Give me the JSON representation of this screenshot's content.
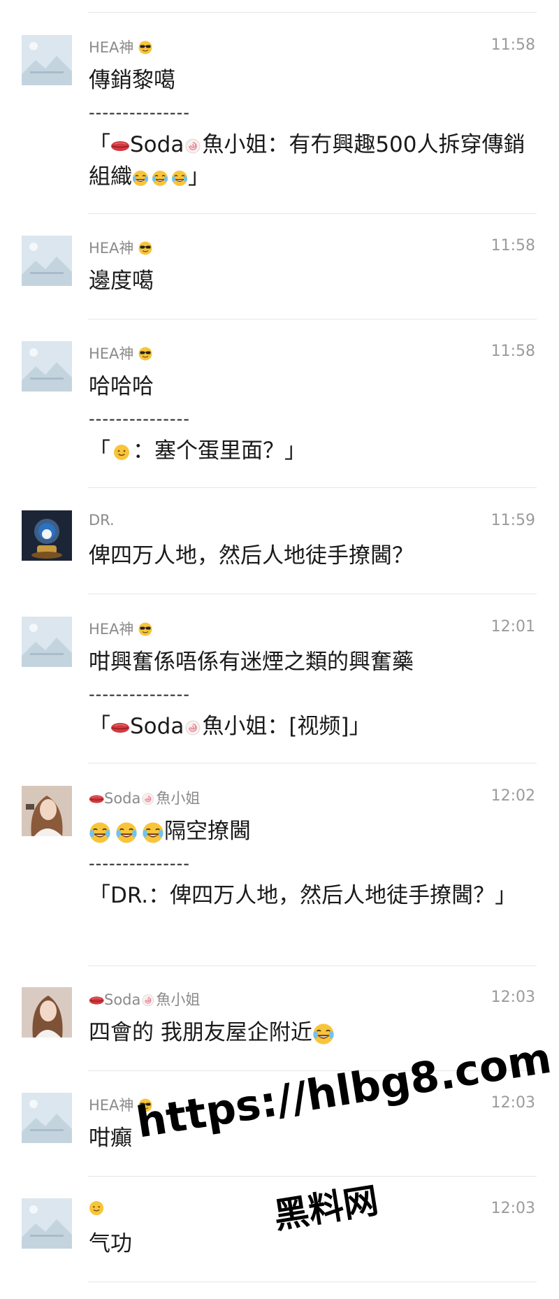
{
  "messages": [
    {
      "sender": "HEA神",
      "sender_emoji": "cool-sunglasses-emoji",
      "avatar": "placeholder-avatar",
      "time": "11:58",
      "text": "傳銷黎噶",
      "quote_divider": "---------------",
      "quote_open": "「",
      "quote_emoji_1": "lips-emoji",
      "quote_name_a": "Soda",
      "quote_emoji_2": "fish-cake-emoji",
      "quote_name_b": "魚小姐",
      "quote_text": "：有冇興趣500人拆穿傳銷組織",
      "quote_tail_emoji": "laughing-crying-emoji",
      "quote_close": "」"
    },
    {
      "sender": "HEA神",
      "sender_emoji": "cool-sunglasses-emoji",
      "avatar": "placeholder-avatar",
      "time": "11:58",
      "text": "邊度噶"
    },
    {
      "sender": "HEA神",
      "sender_emoji": "cool-sunglasses-emoji",
      "avatar": "placeholder-avatar",
      "time": "11:58",
      "text": "哈哈哈",
      "quote_divider": "---------------",
      "quote_open": "「",
      "quote_emoji_1": "smiley-face-emoji",
      "quote_text": "：塞个蛋里面？」"
    },
    {
      "sender": "DR.",
      "avatar": "photo-avatar-figurine",
      "time": "11:59",
      "text": "俾四万人地，然后人地徒手撩閪？"
    },
    {
      "sender": "HEA神",
      "sender_emoji": "cool-sunglasses-emoji",
      "avatar": "placeholder-avatar",
      "time": "12:01",
      "text": "咁興奮係唔係有迷煙之類的興奮藥",
      "quote_divider": "---------------",
      "quote_open": "「",
      "quote_emoji_1": "lips-emoji",
      "quote_name_a": "Soda",
      "quote_emoji_2": "fish-cake-emoji",
      "quote_name_b": "魚小姐",
      "quote_text": "：[视频]」"
    },
    {
      "sender_emoji_1": "lips-emoji",
      "sender": "Soda",
      "sender_emoji_2": "fish-cake-emoji",
      "sender_b": "魚小姐",
      "avatar": "photo-avatar-woman",
      "time": "12:02",
      "text_emoji": "laughing-crying-emoji",
      "text": "隔空撩閪",
      "quote_divider": "---------------",
      "quote_text": "「DR.：俾四万人地，然后人地徒手撩閪？」"
    },
    {
      "sender_emoji_1": "lips-emoji",
      "sender": "Soda",
      "sender_emoji_2": "fish-cake-emoji",
      "sender_b": "魚小姐",
      "avatar": "photo-avatar-woman",
      "time": "12:03",
      "text": "四會的 我朋友屋企附近",
      "text_tail_emoji": "laughing-crying-emoji"
    },
    {
      "sender": "HEA神",
      "sender_emoji": "cool-sunglasses-emoji",
      "avatar": "placeholder-avatar",
      "time": "12:03",
      "text": "咁癲"
    },
    {
      "sender_emoji": "smiley-face-emoji",
      "avatar": "placeholder-avatar",
      "time": "12:03",
      "text": "气功"
    }
  ],
  "watermark": {
    "line1": "https://hlbg8.com",
    "line2": "黑料网"
  },
  "colors": {
    "background": "#ffffff",
    "text": "#1a1a1a",
    "meta": "#8a8a8a",
    "divider": "#e6e6e6",
    "watermark": "#000000"
  }
}
